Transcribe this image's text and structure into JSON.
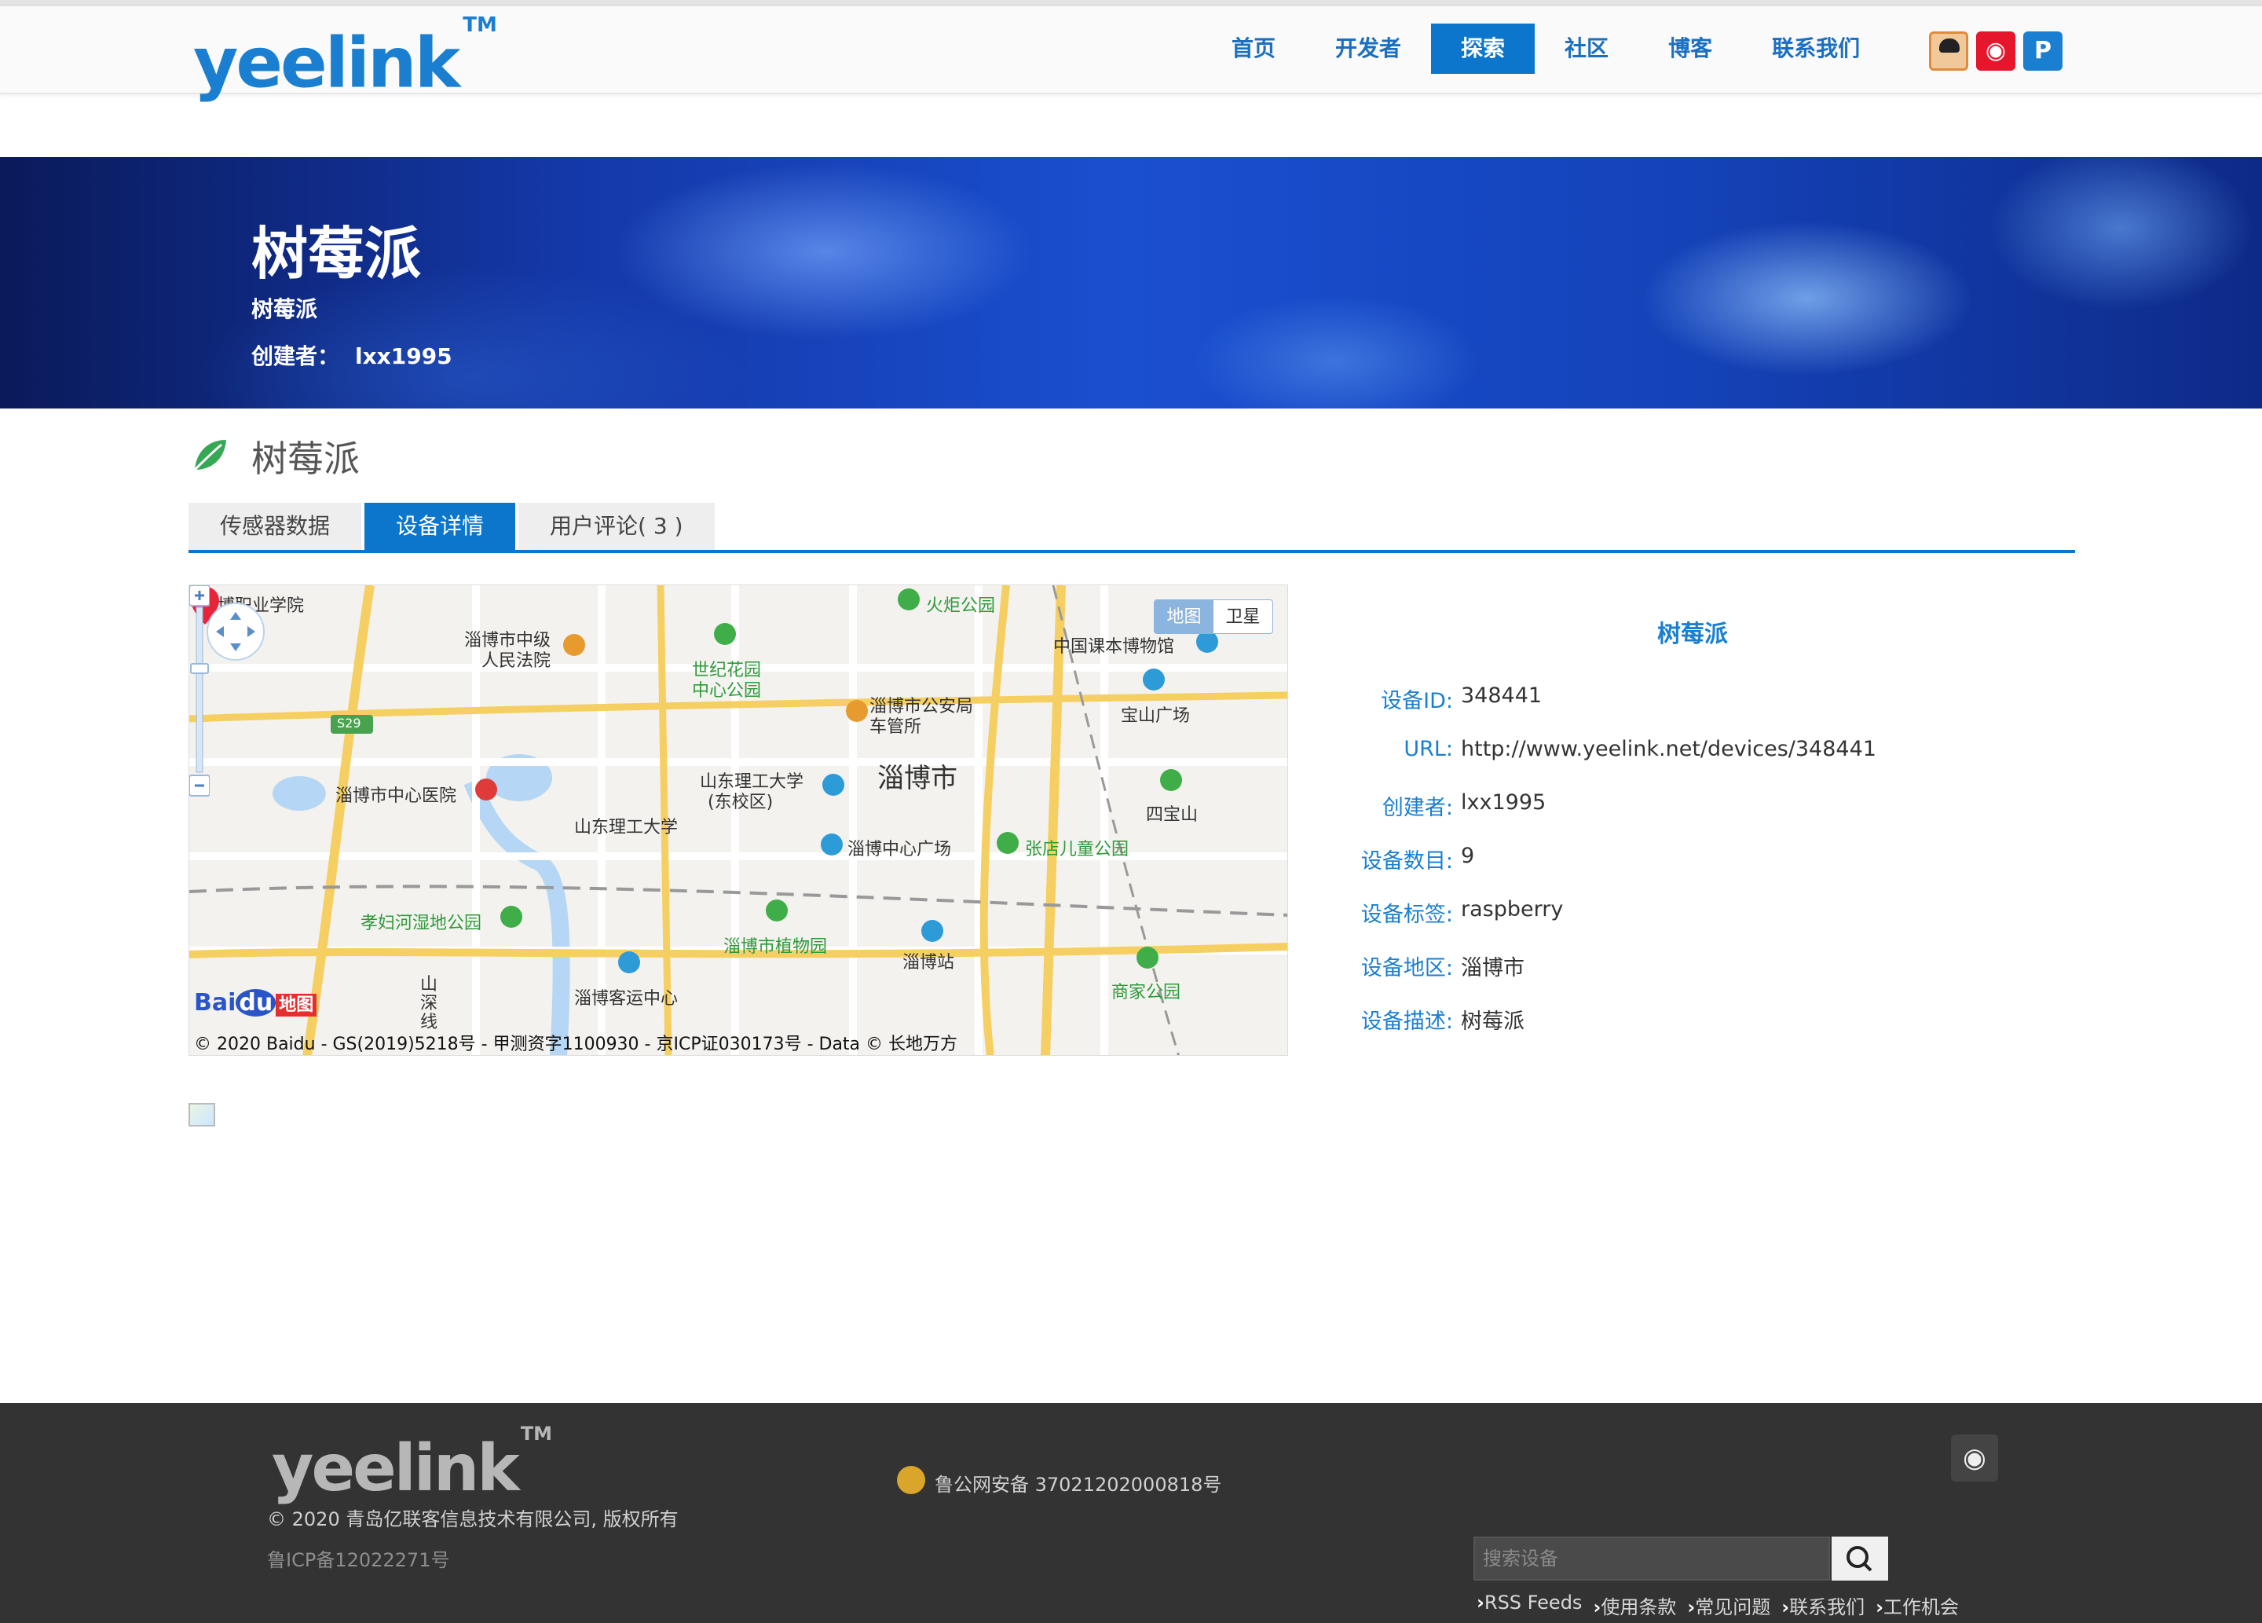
{
  "header": {
    "logo": "yeelink",
    "logo_tm": "TM",
    "nav": [
      "首页",
      "开发者",
      "探索",
      "社区",
      "博客",
      "联系我们"
    ],
    "nav_active_index": 2
  },
  "banner": {
    "title": "树莓派",
    "subtitle": "树莓派",
    "creator_label": "创建者：",
    "creator": "lxx1995"
  },
  "device": {
    "title": "树莓派",
    "tabs": [
      "传感器数据",
      "设备详情",
      "用户评论( 3 )"
    ],
    "active_tab_index": 1
  },
  "map": {
    "switch": [
      "地图",
      "卫星"
    ],
    "labels": [
      "淄博职业学院",
      "淄博市中级",
      "人民法院",
      "世纪花园",
      "中心公园",
      "火炬公园",
      "中国课本博物馆",
      "淄博市公安局",
      "车管所",
      "宝山广场",
      "淄博市中心医院",
      "山东理工大学",
      "山东理工大学",
      "(东校区)",
      "淄博市",
      "四宝山",
      "淄博中心广场",
      "张店儿童公园",
      "孝妇河湿地公园",
      "淄博市植物园",
      "淄博站",
      "淄博客运中心",
      "商家公园",
      "S29",
      "山",
      "深",
      "线"
    ],
    "baidu_logo": "Bai",
    "baidu_logo_2": "du",
    "baidu_logo_3": "地图",
    "copyright": "© 2020 Baidu - GS(2019)5218号 - 甲测资字1100930 - 京ICP证030173号 - Data © 长地万方"
  },
  "details": {
    "title": "树莓派",
    "rows": [
      {
        "label": "设备ID:",
        "value": "348441"
      },
      {
        "label": "URL:",
        "value": "http://www.yeelink.net/devices/348441"
      },
      {
        "label": "创建者:",
        "value": "lxx1995"
      },
      {
        "label": "设备数目:",
        "value": "9"
      },
      {
        "label": "设备标签:",
        "value": "raspberry"
      },
      {
        "label": "设备地区:",
        "value": "淄博市"
      },
      {
        "label": "设备描述:",
        "value": "树莓派"
      }
    ]
  },
  "footer": {
    "logo": "yeelink",
    "logo_tm": "TM",
    "copyright": "© 2020 青岛亿联客信息技术有限公司, 版权所有",
    "icp": "鲁ICP备12022271号",
    "police": "鲁公网安备 37021202000818号",
    "search_placeholder": "搜索设备",
    "links": [
      "RSS Feeds",
      "使用条款",
      "常见问题",
      "联系我们",
      "工作机会"
    ]
  },
  "colors": {
    "brand_blue": "#0b76cc",
    "link_blue": "#1a7fd0",
    "footer_bg": "#333333"
  }
}
